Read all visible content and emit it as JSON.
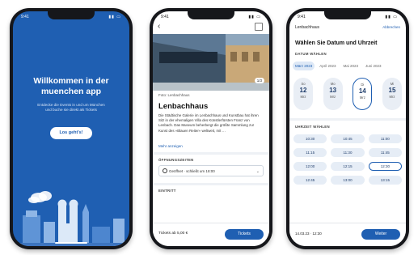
{
  "phone1": {
    "time": "9:41",
    "welcome_title": "Willkommen in der muenchen app",
    "welcome_text": "Entdecke die Events in und um München und buche sie direkt als Tickets",
    "cta_label": "Los geht's!",
    "colors": {
      "background": "#1f5fb2",
      "cta_text": "#1f5fb2"
    }
  },
  "phone2": {
    "time": "9:41",
    "image_counter": "1/3",
    "caption": "Foto: Lenbachhaus",
    "title": "Lenbachhaus",
    "description": "Die Städtische Galerie im Lenbachhaus und Kunstbau hat ihren Sitz in der ehemaligen Villa des Künstlerfürsten Franz von Lenbach. Das Museum beherbergt die größte Sammlung zur Kunst des »Blauen Reiter« weltweit, mit …",
    "more_link": "Mehr anzeigen",
    "hours_label": "ÖFFNUNGSZEITEN",
    "hours_value": "Geöffnet · schließt um 18:00",
    "entry_label": "EINTRITT",
    "price": "Tickets ab 5,00 €",
    "tickets_button": "Tickets",
    "colors": {
      "accent": "#1f5fb2"
    }
  },
  "phone3": {
    "time": "9:41",
    "header_title": "Lenbachhaus",
    "cancel_label": "Abbrechen",
    "title": "Wählen Sie Datum und Uhrzeit",
    "date_label": "DATUM WÄHLEN",
    "months": [
      "März 2023",
      "April 2023",
      "Mai 2023",
      "Juni 2023"
    ],
    "days": [
      {
        "weekday": "So",
        "day": "12",
        "month": "Mrz"
      },
      {
        "weekday": "Mo",
        "day": "13",
        "month": "Mrz"
      },
      {
        "weekday": "Di",
        "day": "14",
        "month": "Mrz"
      },
      {
        "weekday": "Mi",
        "day": "15",
        "month": "Mrz"
      }
    ],
    "time_label": "UHRZEIT WÄHLEN",
    "times": [
      "10:30",
      "10:45",
      "11:00",
      "11:15",
      "11:30",
      "11:45",
      "12:00",
      "12:15",
      "12:30",
      "12:45",
      "13:00",
      "13:15"
    ],
    "summary": "14.03.23 · 12:30",
    "next_button": "Weiter",
    "colors": {
      "accent": "#1f5fb2",
      "chip_bg": "#e6edf6"
    }
  }
}
